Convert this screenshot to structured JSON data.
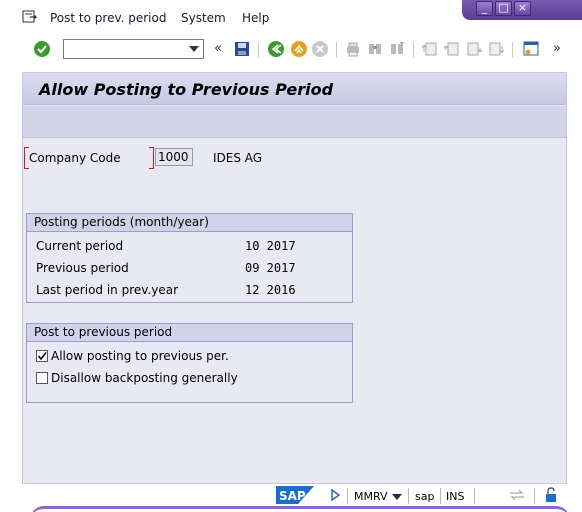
{
  "menu": {
    "items": [
      {
        "label": "Post to prev. period"
      },
      {
        "label": "System"
      },
      {
        "label": "Help"
      }
    ]
  },
  "window_controls": {
    "minimize": "_",
    "maximize": "□",
    "close": "×"
  },
  "toolbar": {
    "command_value": "",
    "overflow": "»",
    "back_arrows": "«"
  },
  "screen": {
    "title": "Allow Posting to Previous Period"
  },
  "company": {
    "label": "Company Code",
    "code": "1000",
    "name": "IDES AG"
  },
  "periods": {
    "heading": "Posting periods (month/year)",
    "rows": [
      {
        "label": "Current period",
        "value": "10 2017"
      },
      {
        "label": "Previous period",
        "value": "09 2017"
      },
      {
        "label": "Last period in prev.year",
        "value": "12 2016"
      }
    ]
  },
  "post_prev": {
    "heading": "Post to previous period",
    "options": [
      {
        "label": "Allow posting to previous per.",
        "checked": true
      },
      {
        "label": "Disallow backposting generally",
        "checked": false
      }
    ]
  },
  "status": {
    "transaction": "MMRV",
    "system": "sap",
    "mode": "INS"
  },
  "colors": {
    "accent": "#6a48a8",
    "frame": "#e9e9f4",
    "title_bar": "#c8c8e4"
  }
}
